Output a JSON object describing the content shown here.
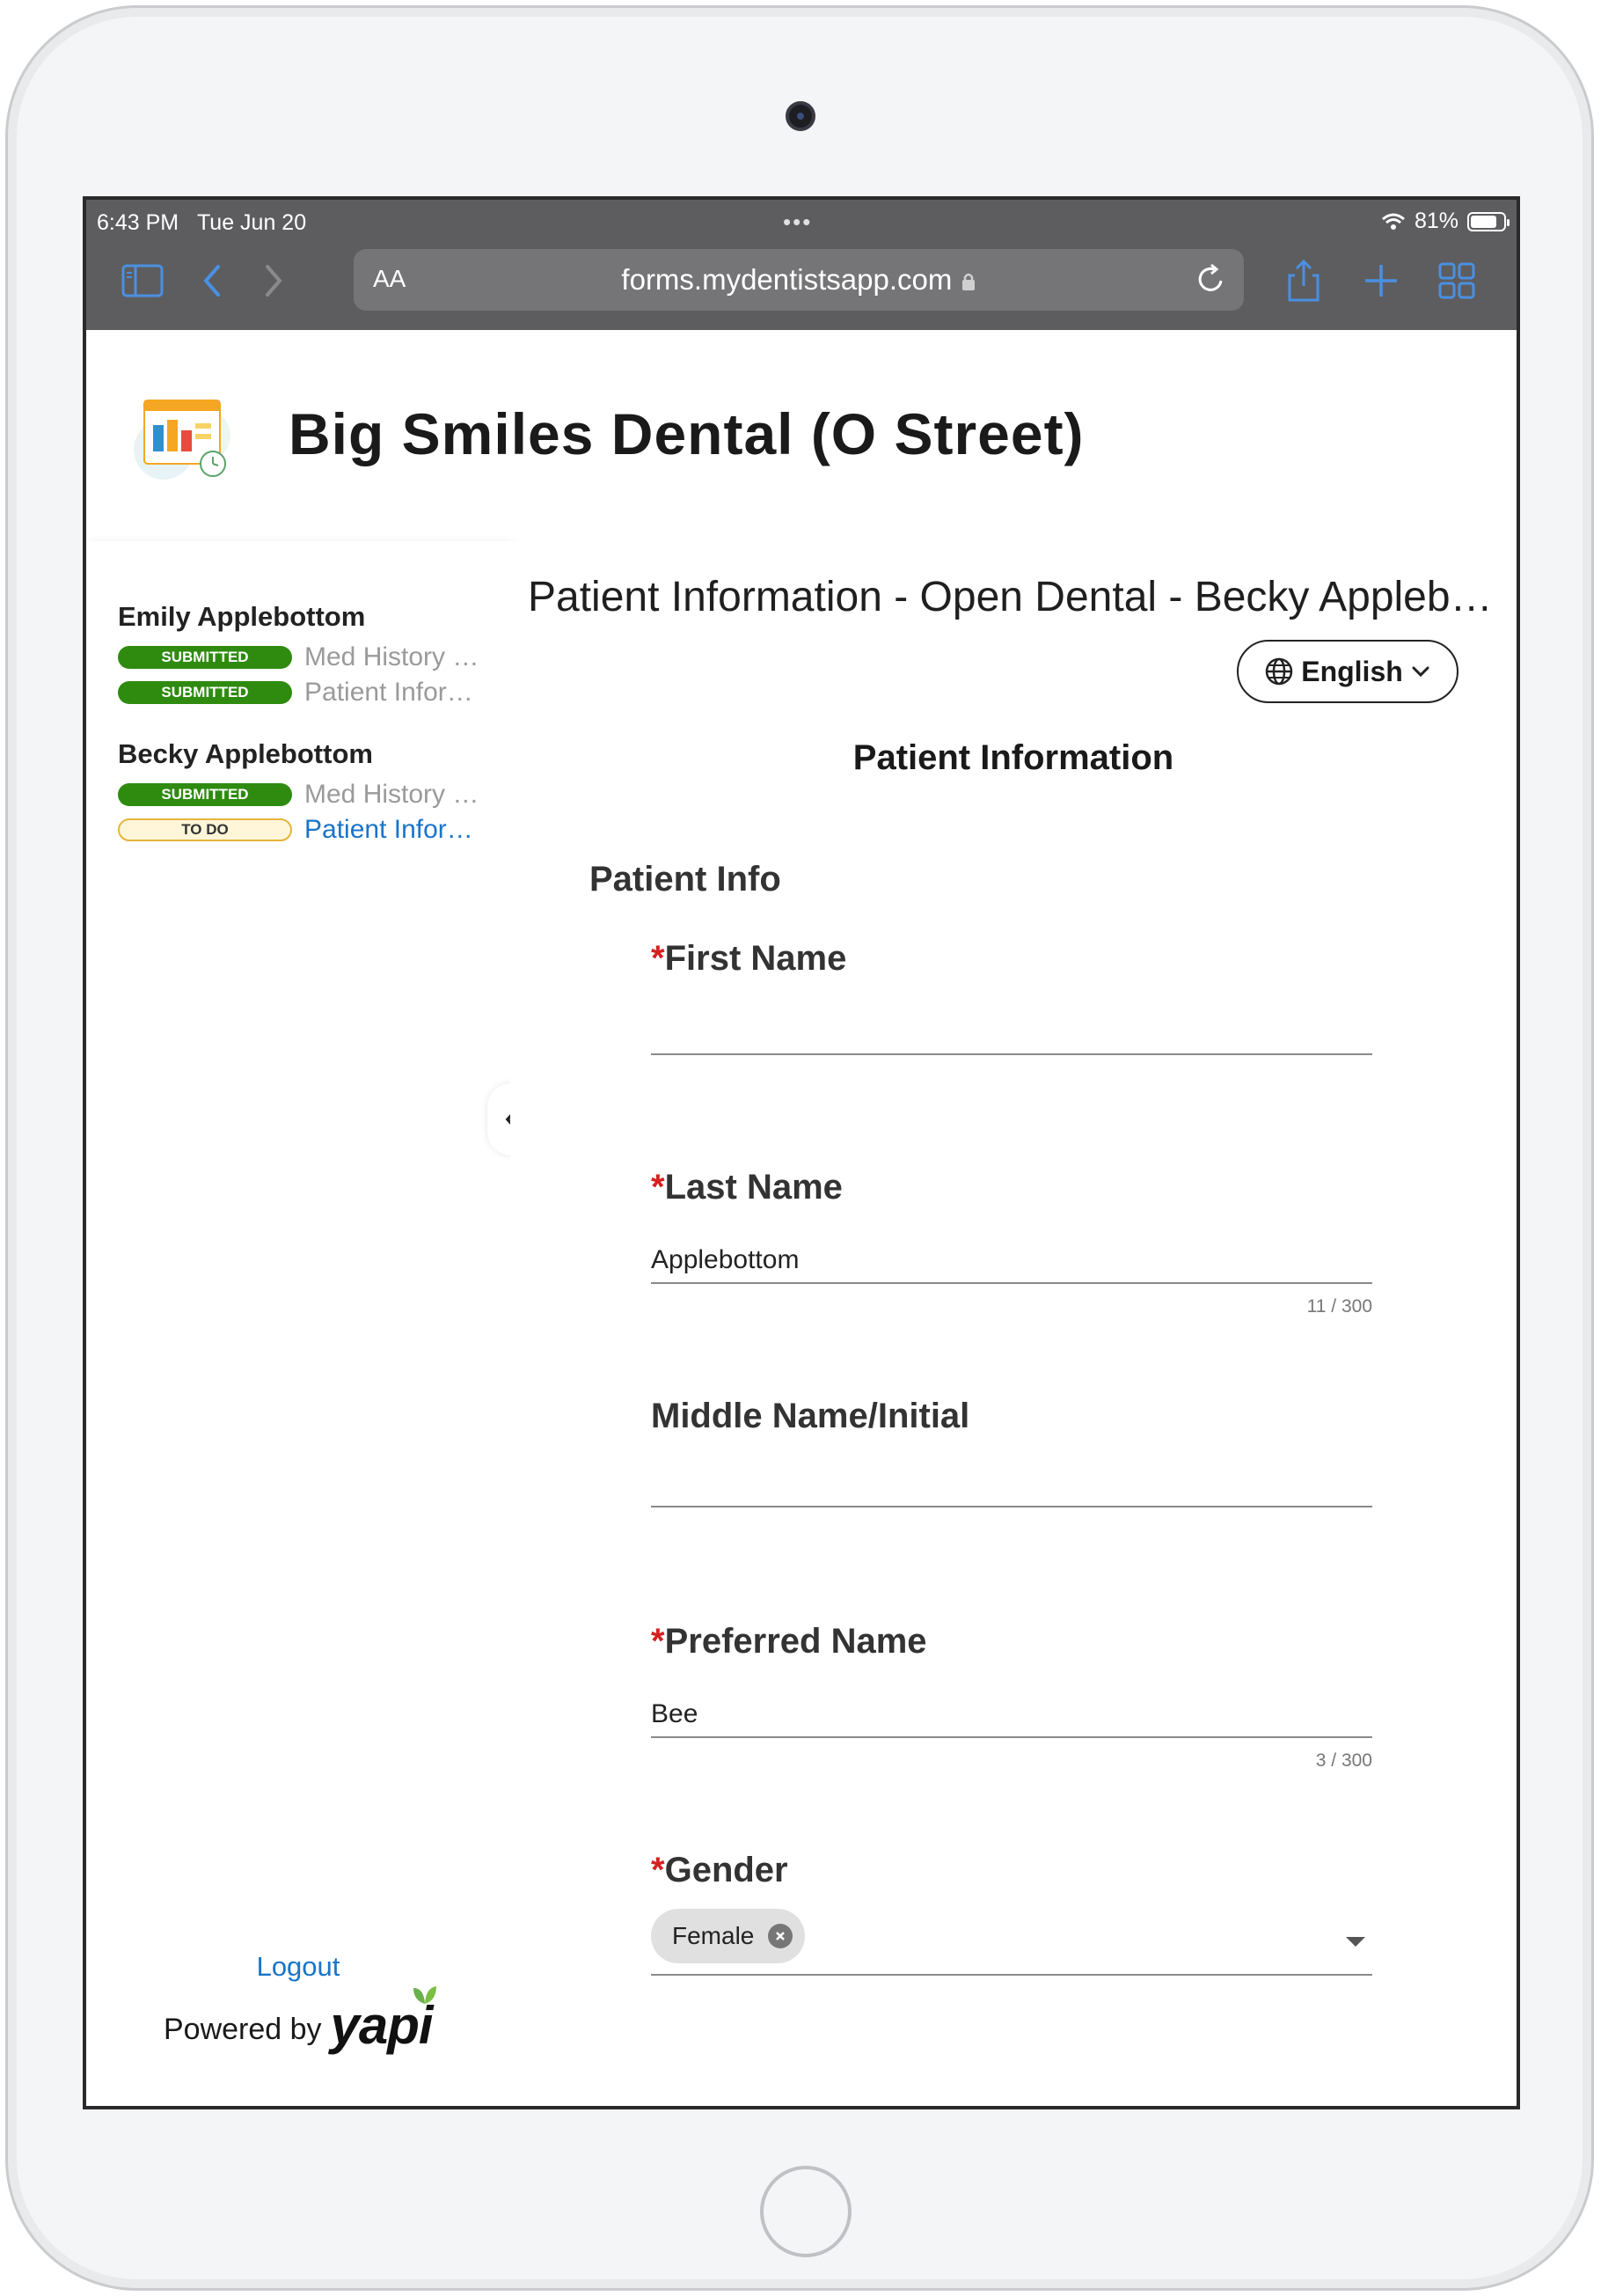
{
  "status_bar": {
    "time": "6:43 PM",
    "date": "Tue Jun 20",
    "battery": "81%",
    "battery_level": 0.81
  },
  "browser": {
    "aa_label": "AA",
    "url": "forms.mydentistsapp.com"
  },
  "header": {
    "clinic_name": "Big Smiles Dental (O Street)"
  },
  "sidebar": {
    "patients": [
      {
        "name": "Emily Applebottom",
        "forms": [
          {
            "status": "SUBMITTED",
            "label": "Med History (A..."
          },
          {
            "status": "SUBMITTED",
            "label": "Patient Inform..."
          }
        ]
      },
      {
        "name": "Becky Applebottom",
        "forms": [
          {
            "status": "SUBMITTED",
            "label": "Med History (A..."
          },
          {
            "status": "TO DO",
            "label": "Patient Inform..."
          }
        ]
      }
    ],
    "logout": "Logout",
    "powered_by": "Powered by",
    "brand": "yapi"
  },
  "main": {
    "form_title": "Patient Information - Open Dental - Becky Applebo...",
    "language": "English",
    "section_title": "Patient Information",
    "group_title": "Patient Info",
    "fields": {
      "first_name": {
        "label": "First Name",
        "required": "*",
        "value": ""
      },
      "last_name": {
        "label": "Last Name",
        "required": "*",
        "value": "Applebottom",
        "counter": "11 / 300"
      },
      "middle_name": {
        "label": "Middle Name/Initial",
        "value": ""
      },
      "preferred_name": {
        "label": "Preferred Name",
        "required": "*",
        "value": "Bee",
        "counter": "3 / 300"
      },
      "gender": {
        "label": "Gender",
        "required": "*",
        "value": "Female"
      }
    }
  },
  "colors": {
    "submitted": "#2e8b0f",
    "todo_bg": "#fff6d9",
    "link": "#1a74c9",
    "required": "#d62020",
    "browser_bar": "#5d5d5f"
  }
}
